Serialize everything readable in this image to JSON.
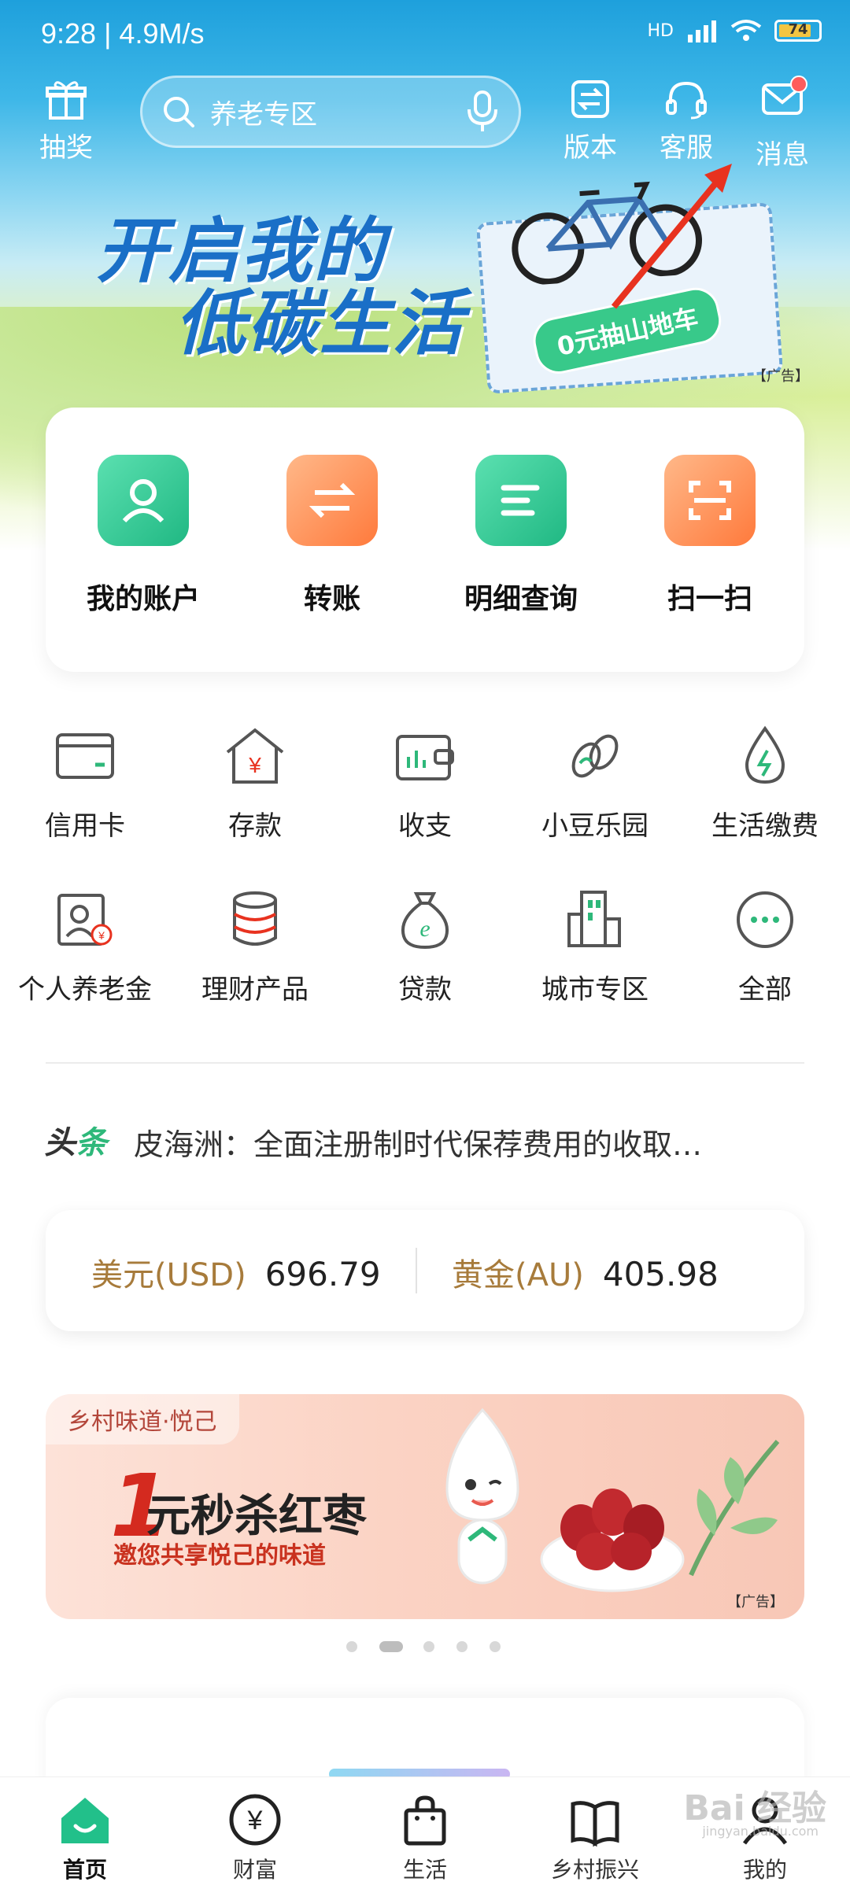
{
  "status_bar": {
    "time_speed": "9:28 | 4.9M/s",
    "network": "HD",
    "battery": "74"
  },
  "top_nav": {
    "lottery_label": "抽奖",
    "search_placeholder": "养老专区",
    "version_label": "版本",
    "service_label": "客服",
    "message_label": "消息"
  },
  "hero": {
    "title_line1": "开启我的",
    "title_line2": "低碳生活",
    "promo_label": "0元抽山地车",
    "ad_tag": "【广告】"
  },
  "quick_actions": [
    {
      "label": "我的账户",
      "icon": "user-icon",
      "color": "#22c08a"
    },
    {
      "label": "转账",
      "icon": "transfer-icon",
      "color": "#ff8a4c"
    },
    {
      "label": "明细查询",
      "icon": "list-icon",
      "color": "#22c08a"
    },
    {
      "label": "扫一扫",
      "icon": "scan-icon",
      "color": "#ff8a4c"
    }
  ],
  "grid_items": [
    {
      "label": "信用卡",
      "icon": "credit-card-icon"
    },
    {
      "label": "存款",
      "icon": "deposit-icon"
    },
    {
      "label": "收支",
      "icon": "wallet-icon"
    },
    {
      "label": "小豆乐园",
      "icon": "bean-icon"
    },
    {
      "label": "生活缴费",
      "icon": "drop-bolt-icon"
    },
    {
      "label": "个人养老金",
      "icon": "pension-icon"
    },
    {
      "label": "理财产品",
      "icon": "coins-stack-icon"
    },
    {
      "label": "贷款",
      "icon": "money-bag-icon"
    },
    {
      "label": "城市专区",
      "icon": "buildings-icon"
    },
    {
      "label": "全部",
      "icon": "more-icon"
    }
  ],
  "news": {
    "tag_a": "头",
    "tag_b": "条",
    "headline": "皮海洲：全面注册制时代保荐费用的收取…"
  },
  "rates": {
    "usd_label": "美元(USD)",
    "usd_value": "696.79",
    "gold_label": "黄金(AU)",
    "gold_value": "405.98"
  },
  "ad_banner": {
    "brand": "乡村味道·悦己",
    "big_number": "1",
    "headline": "元秒杀红枣",
    "sub": "邀您共享悦己的味道",
    "ad_tag": "【广告】",
    "page_count": 5,
    "active_page": 1
  },
  "bottom_nav": [
    {
      "label": "首页",
      "icon": "home-icon",
      "active": true
    },
    {
      "label": "财富",
      "icon": "yen-icon",
      "active": false
    },
    {
      "label": "生活",
      "icon": "bag-icon",
      "active": false
    },
    {
      "label": "乡村振兴",
      "icon": "book-leaf-icon",
      "active": false
    },
    {
      "label": "我的",
      "icon": "person-icon",
      "active": false
    }
  ],
  "watermark": {
    "text": "Bai 经验",
    "sub": "jingyan.baidu.com"
  },
  "colors": {
    "brand_green": "#22c08a",
    "accent_orange": "#ff8a4c",
    "gold_text": "#a77b3b"
  }
}
